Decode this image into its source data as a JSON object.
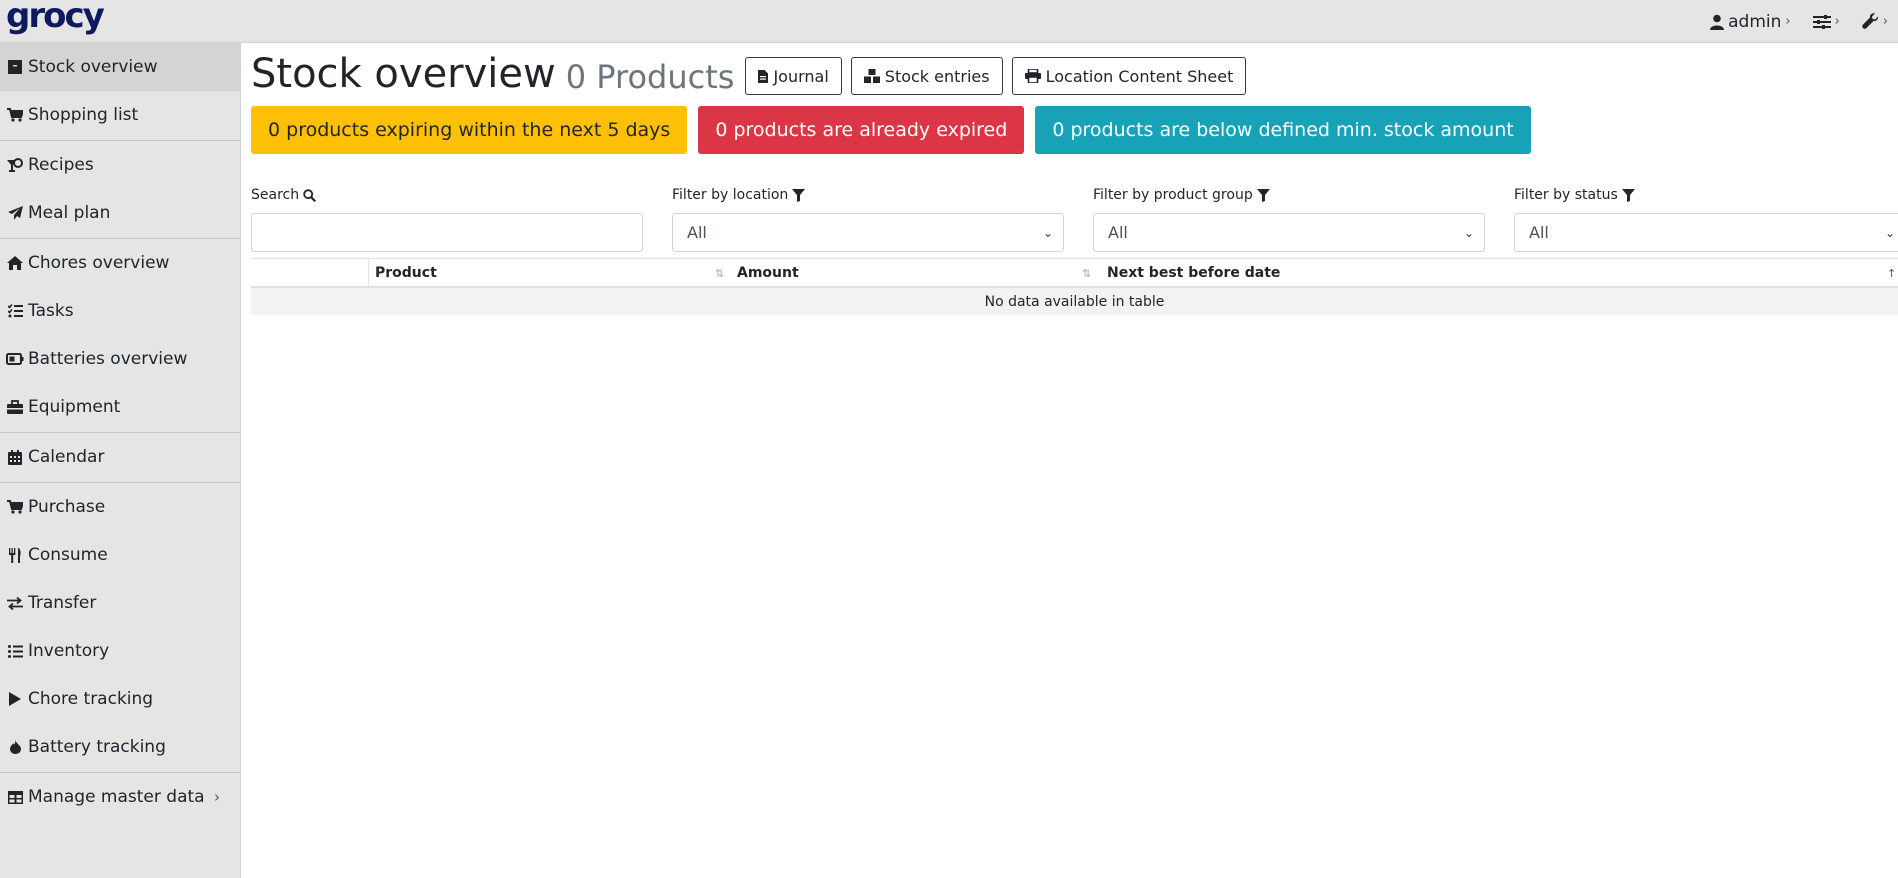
{
  "app": {
    "logo": "grocy"
  },
  "topbar": {
    "user_label": "admin",
    "chevron": "›",
    "items": [
      {
        "icon": "user-icon",
        "label": "admin"
      },
      {
        "icon": "sliders-icon",
        "label": ""
      },
      {
        "icon": "wrench-icon",
        "label": ""
      }
    ]
  },
  "sidebar": {
    "items": [
      {
        "label": "Stock overview",
        "icon": "box-icon",
        "glyph": "▪"
      },
      {
        "label": "Shopping list",
        "icon": "cart-icon",
        "glyph": "🛒"
      },
      {
        "label": "Recipes",
        "icon": "utensils-icon",
        "glyph": "♨"
      },
      {
        "label": "Meal plan",
        "icon": "paper-plane-icon",
        "glyph": "➤"
      },
      {
        "label": "Chores overview",
        "icon": "home-icon",
        "glyph": "⌂"
      },
      {
        "label": "Tasks",
        "icon": "tasks-icon",
        "glyph": "☰"
      },
      {
        "label": "Batteries overview",
        "icon": "battery-icon",
        "glyph": "▭"
      },
      {
        "label": "Equipment",
        "icon": "toolbox-icon",
        "glyph": "▤"
      },
      {
        "label": "Calendar",
        "icon": "calendar-icon",
        "glyph": "▦"
      },
      {
        "label": "Purchase",
        "icon": "cart-icon",
        "glyph": "🛒"
      },
      {
        "label": "Consume",
        "icon": "fork-knife-icon",
        "glyph": "ψ"
      },
      {
        "label": "Transfer",
        "icon": "exchange-icon",
        "glyph": "⇄"
      },
      {
        "label": "Inventory",
        "icon": "list-icon",
        "glyph": "☷"
      },
      {
        "label": "Chore tracking",
        "icon": "play-icon",
        "glyph": "▶"
      },
      {
        "label": "Battery tracking",
        "icon": "fire-icon",
        "glyph": "◆"
      },
      {
        "label": "Manage master data",
        "icon": "table-icon",
        "glyph": "▦"
      }
    ]
  },
  "header": {
    "title": "Stock overview",
    "count": "0 Products",
    "buttons": {
      "journal": "Journal",
      "stock_entries": "Stock entries",
      "location_sheet": "Location Content Sheet"
    }
  },
  "alerts": {
    "expiring": "0 products expiring within the next 5 days",
    "expired": "0 products are already expired",
    "below_min": "0 products are below defined min. stock amount"
  },
  "filters": {
    "search_label": "Search",
    "location_label": "Filter by location",
    "group_label": "Filter by product group",
    "status_label": "Filter by status",
    "location_value": "All",
    "group_value": "All",
    "status_value": "All"
  },
  "table": {
    "columns": [
      "Product",
      "Amount",
      "Next best before date"
    ],
    "empty_text": "No data available in table"
  },
  "colors": {
    "warning": "#ffc107",
    "danger": "#dc3545",
    "info": "#17a2b8",
    "sidebar_bg": "#e5e5e5"
  }
}
